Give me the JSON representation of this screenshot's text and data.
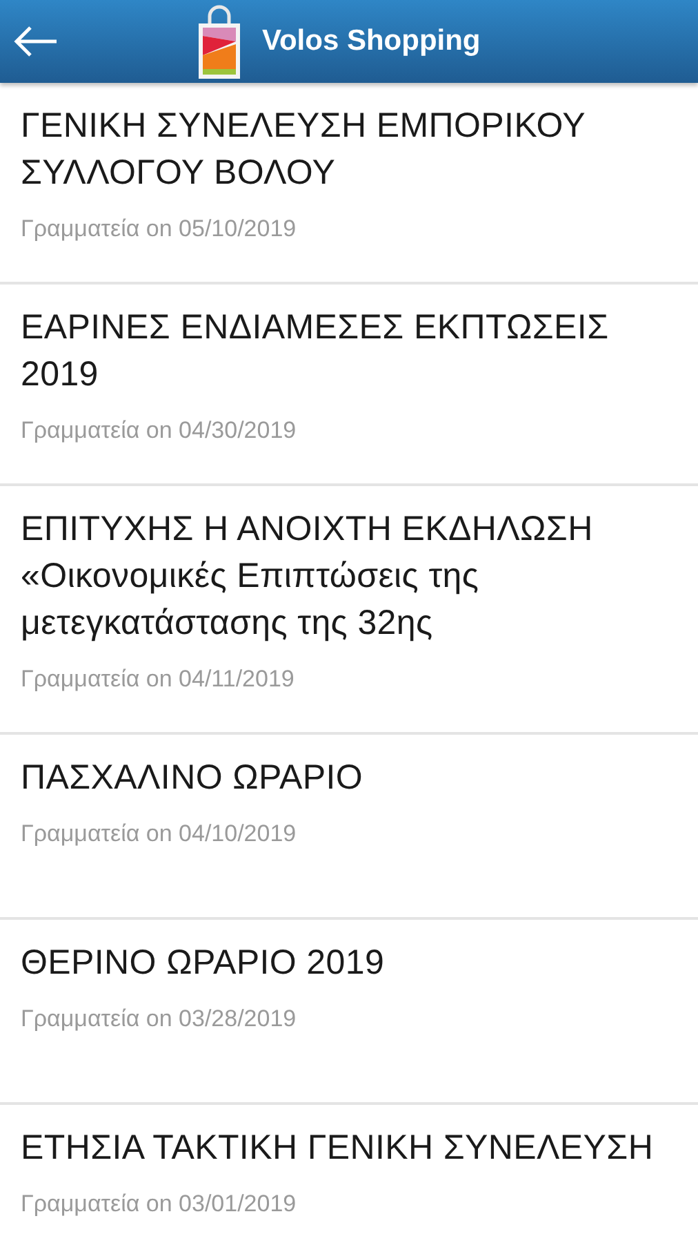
{
  "app_bar": {
    "title": "Volos Shopping"
  },
  "posts": [
    {
      "title": "ΓΕΝΙΚΗ ΣΥΝΕΛΕΥΣΗ ΕΜΠΟΡΙΚΟΥ ΣΥΛΛΟΓΟΥ ΒΟΛΟΥ",
      "meta": "Γραμματεία on 05/10/2019"
    },
    {
      "title": "ΕΑΡΙΝΕΣ ΕΝΔΙΑΜΕΣΕΣ ΕΚΠΤΩΣΕΙΣ 2019",
      "meta": "Γραμματεία on 04/30/2019"
    },
    {
      "title": "ΕΠΙΤΥΧΗΣ Η ΑΝΟΙΧΤΗ ΕΚΔΗΛΩΣΗ «Οικονομικές Επιπτώσεις της μετεγκατάστασης της 32ης",
      "meta": "Γραμματεία on 04/11/2019"
    },
    {
      "title": "ΠΑΣΧΑΛΙΝΟ ΩΡΑΡΙΟ",
      "meta": "Γραμματεία on 04/10/2019"
    },
    {
      "title": "ΘΕΡΙΝΟ ΩΡΑΡΙΟ 2019",
      "meta": "Γραμματεία on 03/28/2019"
    },
    {
      "title": "ΕΤΗΣΙΑ ΤΑΚΤΙΚΗ ΓΕΝΙΚΗ ΣΥΝΕΛΕΥΣΗ",
      "meta": "Γραμματεία on 03/01/2019"
    }
  ]
}
